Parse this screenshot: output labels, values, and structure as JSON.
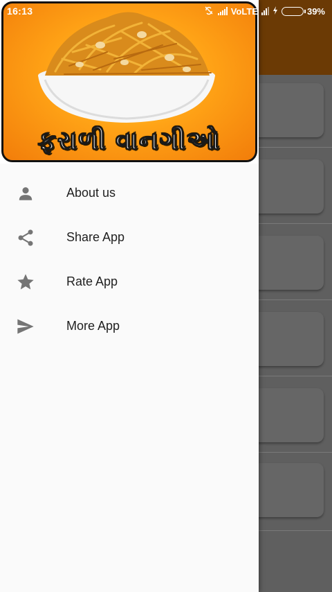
{
  "status_bar": {
    "time": "16:13",
    "network": "VoLTE",
    "battery_percent": "39%",
    "battery_level": 0.39
  },
  "drawer": {
    "banner_title": "ફરાળી વાનગીઓ",
    "items": [
      {
        "label": "About us",
        "icon": "person-icon"
      },
      {
        "label": "Share App",
        "icon": "share-icon"
      },
      {
        "label": "Rate App",
        "icon": "star-icon"
      },
      {
        "label": "More App",
        "icon": "send-icon"
      }
    ]
  },
  "colors": {
    "toolbar": "#6b3a05",
    "banner_orange": "#f8a01a",
    "icon_gray": "#757575",
    "scrim": "#5f5f5f"
  }
}
